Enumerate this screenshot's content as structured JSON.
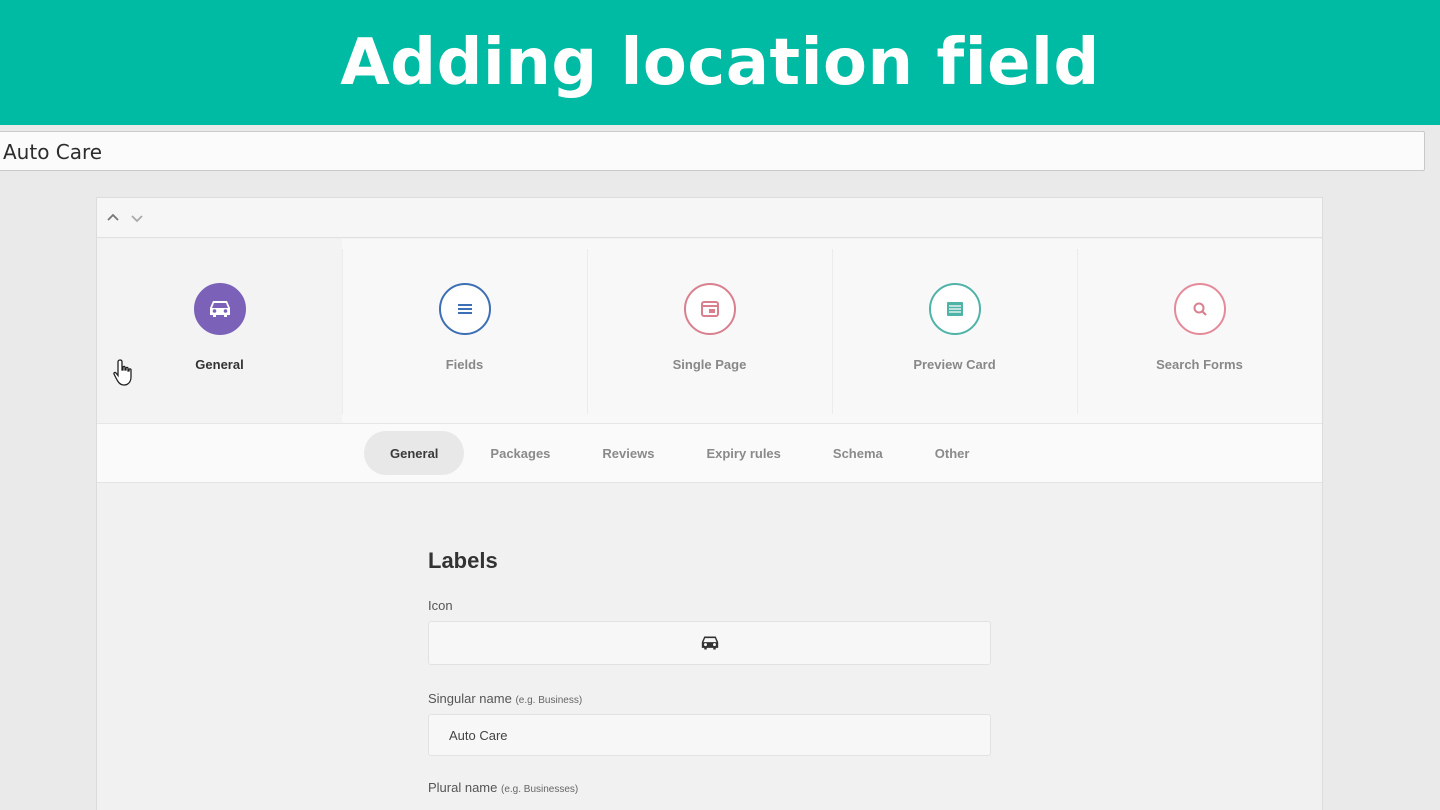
{
  "banner": {
    "title": "Adding location field"
  },
  "title_input": {
    "value": "Auto Care"
  },
  "steps": [
    {
      "label": "General",
      "icon": "car-icon",
      "color": "#7b62b8"
    },
    {
      "label": "Fields",
      "icon": "list-icon",
      "color": "#3d6fb5"
    },
    {
      "label": "Single Page",
      "icon": "window-icon",
      "color": "#d9808f"
    },
    {
      "label": "Preview Card",
      "icon": "card-icon",
      "color": "#4fb3a8"
    },
    {
      "label": "Search Forms",
      "icon": "search-icon",
      "color": "#e58a99"
    }
  ],
  "tabs": [
    "General",
    "Packages",
    "Reviews",
    "Expiry rules",
    "Schema",
    "Other"
  ],
  "form": {
    "heading": "Labels",
    "icon_label": "Icon",
    "icon_value": "car-icon",
    "singular_label": "Singular name",
    "singular_hint": "(e.g. Business)",
    "singular_value": "Auto Care",
    "plural_label": "Plural name",
    "plural_hint": "(e.g. Businesses)"
  }
}
